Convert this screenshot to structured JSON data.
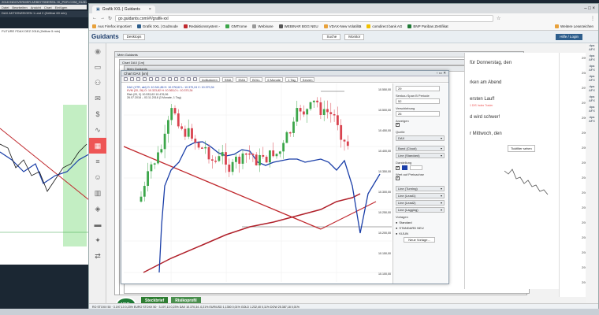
{
  "bg_app": {
    "title": "2018 INDOVERMER ARBEITSBEREIL HI_PDR.COM_GUIDANT",
    "menu": [
      "Datei",
      "Bearbeiten",
      "Ansicht",
      "Chart",
      "Einfügen"
    ],
    "chart1_title": "DAX FUTURES (FDAX 12/2018) C 10368,5",
    "chart2_title": "FUTURE FDAX DEZ 2018 (Zeitbar 5 min)",
    "label_a": "DAX AKTIONZEIGEN 1 und 2 (Zeitbar 60 min)"
  },
  "browser": {
    "tabs": [
      {
        "label": "Grafik XXL | Guidants",
        "active": true
      }
    ],
    "url": "go.guidants.com/#!/grafik-xxl",
    "bookmarks": [
      "Aus Firefox importiert",
      "Grafik XXL | Godmode",
      "Redaktionssystem -",
      "GMTrome",
      "Webinare",
      "WEBINAR BGG NEU",
      "VDAX-New Volatilitä",
      "comdirect bank AG",
      "BNP Paribas Zertifikat"
    ],
    "bookmarks_right": "Weitere Lesezeichen"
  },
  "site": {
    "logo": "Guidants",
    "desktop_btn": "Desktops",
    "search_btn": "Suche",
    "monitor_btn": "Monitor",
    "help_btn": "Hilfe / Login"
  },
  "windows": {
    "back1_title": "Mein Guidants",
    "back2_title": "Chart DAX [1m]",
    "back3_title": "Mein Guidants",
    "chart_title": "Chart DAX [xm]"
  },
  "chart_toolbar": {
    "indicators": "Indikatoren",
    "sma": "SMA",
    "ema": "EMA",
    "boll": "BOLL",
    "period": "6 Monate",
    "interval": "1 Tag",
    "extra": "Kerzen"
  },
  "chart_info": {
    "line1": "DAX (XTR, akt)  O: 10.341,86  H: 10.378,62  L: 10.370,24  C: 10.370,34",
    "line2": "KVM (20, 26)  O: 10.323,82  H: 10.363,0  L: 10.370,34",
    "line3": "Risk (20, 0)  10.533,63  10.476,06",
    "line4": "26.07.2018 – 03.11.2018  (3 Monate, 1 Tag)"
  },
  "settings": {
    "label_period": "29",
    "label_senkou": "Senkou Span B Periode",
    "val_senkou": "52",
    "label_shift": "Verschiebung",
    "val_shift": "26",
    "label_show": "Anzeigen",
    "label_source": "Quelle",
    "val_source": "DAX",
    "band_label": "Band (Cloud)",
    "line_std": "Line (Standard)",
    "label_display": "Darstellung",
    "label_value": "Wert auf Preisachse",
    "line_turning": "Line (Turning)",
    "line_lead1": "Line (Lead1)",
    "line_lead2": "Line (Lead2)",
    "line_lagging": "Line (Lagging)",
    "label_vorlagen": "Vorlagen",
    "opt_std": "Standard",
    "opt_std_neu": "STANDARD NEU",
    "opt_kijun": "KIJUN",
    "new_template": "Neue Vorlage..."
  },
  "news": {
    "items": [
      {
        "text": "für Donnerstag, den"
      },
      {
        "text": "rken am Abend"
      },
      {
        "text": "ersten Lauf!"
      },
      {
        "text": "d wird schwer!"
      },
      {
        "text": "r Mittwoch, den"
      }
    ],
    "sub": "1 DIS Index Trader",
    "more_btn": "Tickfilter sehen"
  },
  "right_axis": {
    "labels": [
      "2990",
      "2980",
      "2975",
      "2970",
      "2965",
      "2960",
      "2955",
      "2950",
      "2945",
      "2940",
      "2935",
      "2930",
      "2925",
      "2920",
      "2915",
      "2910"
    ]
  },
  "price_axis": {
    "labels": [
      "10.550,00",
      "10.500,00",
      "10.450,00",
      "10.400,00",
      "10.350,00",
      "10.300,00",
      "10.250,00",
      "10.200,00",
      "10.150,00",
      "10.100,00"
    ]
  },
  "bottom": {
    "tab_steckbrief": "Steckbrief",
    "tab_risiko": "Risikoprofil",
    "xxl": "XXL",
    "ticker": "RO STOXX 50 · 3.197,13  0,23%   EURO STOXX 50  · 3.197,13  0,23%   DAX 10.370,34  -0,21%   EUR/USD 1,1350  0,01%   GOLD  1.232,40  0,11%   DOW 25.387,18  0,01%"
  },
  "colors": {
    "candle_up": "#3ca64a",
    "candle_down": "#d9434f",
    "line_blue": "#1a3ea8",
    "line_red": "#c0292e",
    "line_gray": "#8a8a8a"
  }
}
